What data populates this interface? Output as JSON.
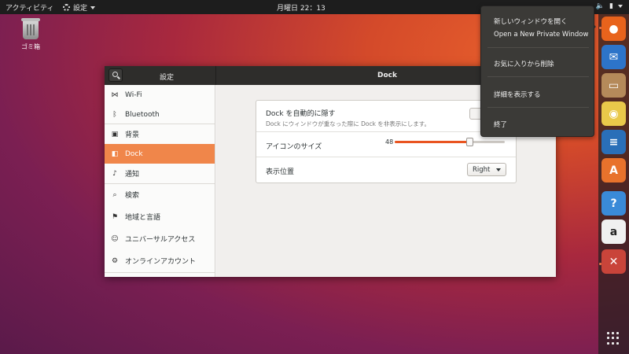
{
  "topbar": {
    "activities": "アクティビティ",
    "app_menu": "設定",
    "clock": "月曜日 22：13"
  },
  "desktop": {
    "trash_label": "ゴミ箱"
  },
  "window": {
    "sidebar_title": "設定",
    "main_title": "Dock",
    "sidebar_items": [
      {
        "icon": "wifi-icon",
        "glyph": "⋈",
        "label": "Wi-Fi"
      },
      {
        "icon": "bluetooth-icon",
        "glyph": "ᛒ",
        "label": "Bluetooth"
      },
      {
        "icon": "background-icon",
        "glyph": "▣",
        "label": "背景"
      },
      {
        "icon": "dock-icon",
        "glyph": "◧",
        "label": "Dock"
      },
      {
        "icon": "notification-icon",
        "glyph": "♪",
        "label": "通知"
      },
      {
        "icon": "search-icon",
        "glyph": "⌕",
        "label": "検索"
      },
      {
        "icon": "region-icon",
        "glyph": "⚑",
        "label": "地域と言語"
      },
      {
        "icon": "accessibility-icon",
        "glyph": "☺",
        "label": "ユニバーサルアクセス"
      },
      {
        "icon": "online-accounts-icon",
        "glyph": "⚙",
        "label": "オンラインアカウント"
      }
    ],
    "selected_index": 3,
    "dock_settings": {
      "autohide_label": "Dock を自動的に隠す",
      "autohide_desc": "Dock にウィンドウが重なった際に Dock を非表示にします。",
      "icon_size_label": "アイコンのサイズ",
      "icon_size_value": "48",
      "icon_size_fraction": 0.68,
      "position_label": "表示位置",
      "position_value": "Right"
    }
  },
  "context_menu": {
    "items": [
      "新しいウィンドウを開く",
      "Open a New Private Window",
      "お気に入りから削除",
      "詳細を表示する",
      "終了"
    ]
  },
  "dock": {
    "apps": [
      {
        "name": "firefox-icon",
        "bg": "#e8631c",
        "glyph": "●"
      },
      {
        "name": "thunderbird-icon",
        "bg": "#2d74c9",
        "glyph": "✉"
      },
      {
        "name": "files-icon",
        "bg": "#b58a5a",
        "glyph": "▭"
      },
      {
        "name": "rhythmbox-icon",
        "bg": "#e9c84a",
        "glyph": "◉"
      },
      {
        "name": "writer-icon",
        "bg": "#2a6fb8",
        "glyph": "≡"
      },
      {
        "name": "software-icon",
        "bg": "#e8722c",
        "glyph": "A"
      },
      {
        "name": "help-icon",
        "bg": "#3a8ad8",
        "glyph": "?"
      },
      {
        "name": "amazon-icon",
        "bg": "#f0f0f0",
        "glyph": "a"
      },
      {
        "name": "settings-icon",
        "bg": "#c9443a",
        "glyph": "✕"
      }
    ]
  }
}
